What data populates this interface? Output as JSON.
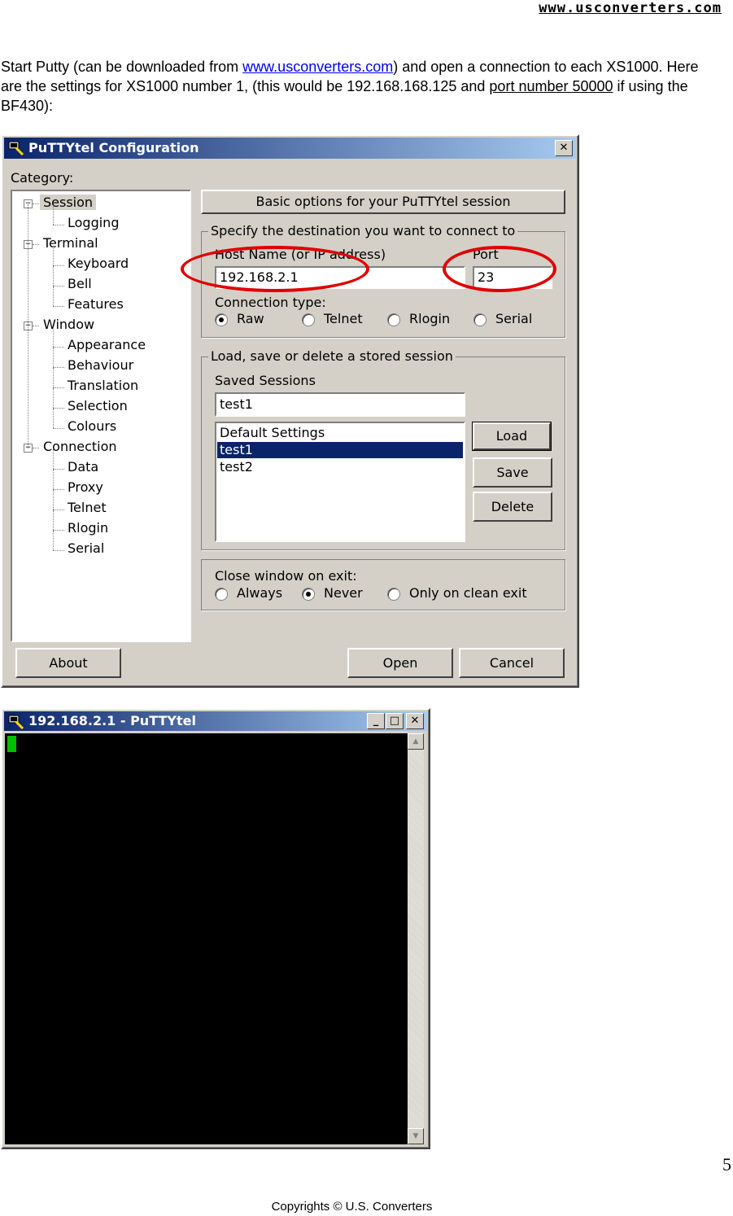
{
  "header": {
    "site": "www.usconverters.com"
  },
  "intro": {
    "part1": "Start Putty (can be downloaded from ",
    "link": "www.usconverters.com",
    "part2": ") and open a connection to each XS1000. Here are the settings for XS1000 number 1, (this would be 192.168.168.125 and ",
    "underlined": "port number 50000",
    "part3": " if using the BF430):"
  },
  "config_window": {
    "title": "PuTTYtel Configuration",
    "close_glyph": "✕",
    "category_label": "Category:",
    "tree": [
      {
        "label": "Session",
        "level": 0,
        "expanded": true,
        "selected": true
      },
      {
        "label": "Logging",
        "level": 1
      },
      {
        "label": "Terminal",
        "level": 0,
        "expanded": true
      },
      {
        "label": "Keyboard",
        "level": 1
      },
      {
        "label": "Bell",
        "level": 1
      },
      {
        "label": "Features",
        "level": 1
      },
      {
        "label": "Window",
        "level": 0,
        "expanded": true
      },
      {
        "label": "Appearance",
        "level": 1
      },
      {
        "label": "Behaviour",
        "level": 1
      },
      {
        "label": "Translation",
        "level": 1
      },
      {
        "label": "Selection",
        "level": 1
      },
      {
        "label": "Colours",
        "level": 1
      },
      {
        "label": "Connection",
        "level": 0,
        "expanded": true
      },
      {
        "label": "Data",
        "level": 1
      },
      {
        "label": "Proxy",
        "level": 1
      },
      {
        "label": "Telnet",
        "level": 1
      },
      {
        "label": "Rlogin",
        "level": 1
      },
      {
        "label": "Serial",
        "level": 1
      }
    ],
    "panel_title": "Basic options for your PuTTYtel session",
    "destination": {
      "group_label": "Specify the destination you want to connect to",
      "host_label": "Host Name (or IP address)",
      "host_value": "192.168.2.1",
      "port_label": "Port",
      "port_value": "23",
      "conn_type_label": "Connection type:",
      "conn_types": [
        {
          "label": "Raw",
          "checked": true
        },
        {
          "label": "Telnet",
          "checked": false
        },
        {
          "label": "Rlogin",
          "checked": false
        },
        {
          "label": "Serial",
          "checked": false
        }
      ]
    },
    "sessions": {
      "group_label": "Load, save or delete a stored session",
      "saved_label": "Saved Sessions",
      "saved_value": "test1",
      "list": [
        {
          "label": "Default Settings",
          "selected": false
        },
        {
          "label": "test1",
          "selected": true
        },
        {
          "label": "test2",
          "selected": false
        }
      ],
      "load": "Load",
      "save": "Save",
      "delete": "Delete"
    },
    "close": {
      "group_label": "Close window on exit:",
      "options": [
        {
          "label": "Always",
          "checked": false
        },
        {
          "label": "Never",
          "checked": true
        },
        {
          "label": "Only on clean exit",
          "checked": false
        }
      ]
    },
    "about": "About",
    "open": "Open",
    "cancel": "Cancel"
  },
  "terminal_window": {
    "title": "192.168.2.1 - PuTTYtel",
    "min_glyph": "_",
    "max_glyph": "□",
    "close_glyph": "✕",
    "cursor_color": "#00c000"
  },
  "highlight_color": "#e00000",
  "footer": {
    "page_number": "5",
    "copyright": "Copyrights © U.S. Converters"
  }
}
